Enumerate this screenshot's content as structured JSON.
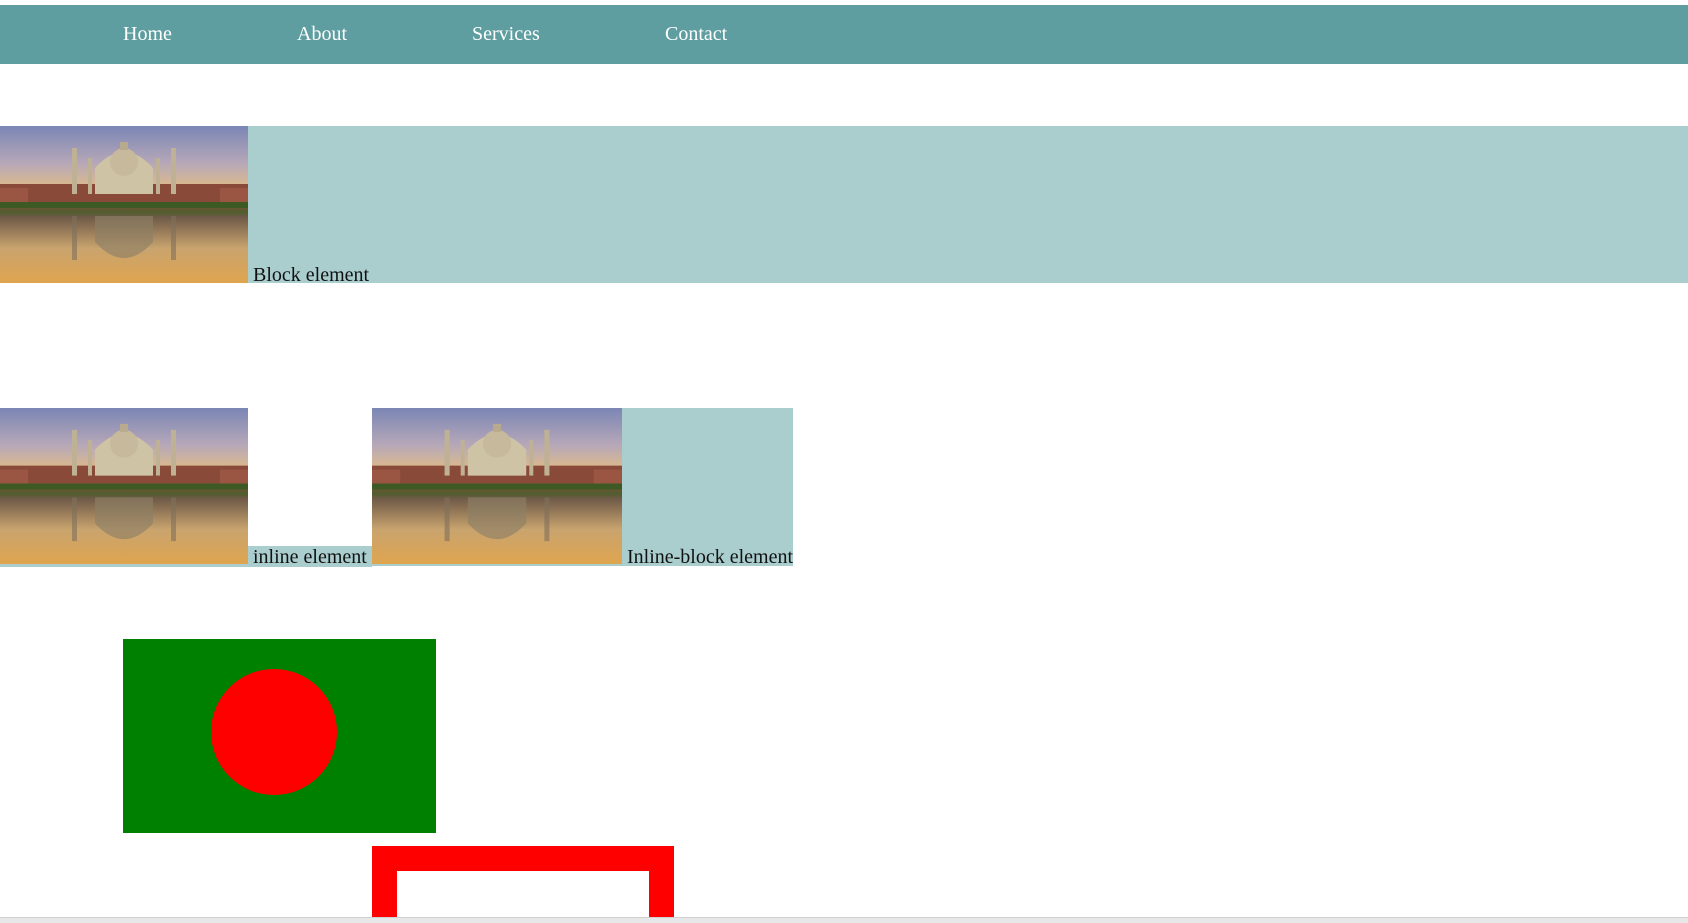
{
  "nav": {
    "items": [
      {
        "label": "Home"
      },
      {
        "label": "About"
      },
      {
        "label": "Services"
      },
      {
        "label": "Contact"
      }
    ]
  },
  "block_demo": {
    "caption": "Block element"
  },
  "inline_demo": {
    "caption": "inline element"
  },
  "inline_block_demo": {
    "caption": "Inline-block element"
  },
  "colors": {
    "nav_bg": "#5f9ea0",
    "band_bg": "#aacdce",
    "flag_green": "#008000",
    "flag_red": "#ff0000",
    "frame_red": "#ff0000"
  }
}
